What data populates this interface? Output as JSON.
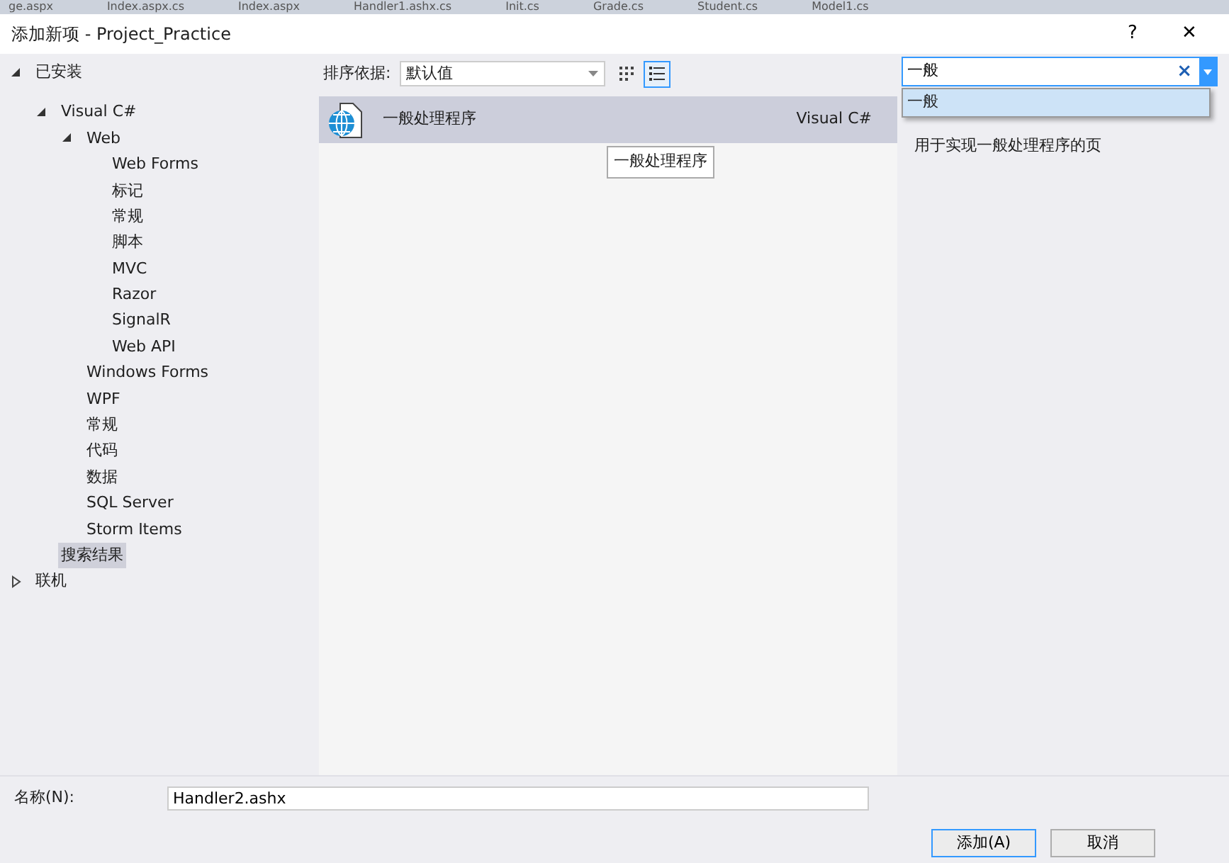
{
  "background_tabs": [
    "ge.aspx",
    "Index.aspx.cs",
    "Index.aspx",
    "Handler1.ashx.cs",
    "Init.cs",
    "Grade.cs",
    "Student.cs",
    "Model1.cs"
  ],
  "window": {
    "title": "添加新项 - Project_Practice",
    "help": "?",
    "close": "✕"
  },
  "tree": [
    {
      "label": "已安装",
      "expanded": true,
      "selected": false,
      "children": [
        {
          "label": "Visual C#",
          "expanded": true,
          "selected": false,
          "children": [
            {
              "label": "Web",
              "expanded": true,
              "selected": false,
              "children": [
                {
                  "label": "Web Forms",
                  "selected": false
                },
                {
                  "label": "标记",
                  "selected": false
                },
                {
                  "label": "常规",
                  "selected": false
                },
                {
                  "label": "脚本",
                  "selected": false
                },
                {
                  "label": "MVC",
                  "selected": false
                },
                {
                  "label": "Razor",
                  "selected": false
                },
                {
                  "label": "SignalR",
                  "selected": false
                },
                {
                  "label": "Web API",
                  "selected": false
                }
              ]
            },
            {
              "label": "Windows Forms",
              "selected": false
            },
            {
              "label": "WPF",
              "selected": false
            },
            {
              "label": "常规",
              "selected": false
            },
            {
              "label": "代码",
              "selected": false
            },
            {
              "label": "数据",
              "selected": false
            },
            {
              "label": "SQL Server",
              "selected": false
            },
            {
              "label": "Storm Items",
              "selected": false
            }
          ]
        },
        {
          "label": "搜索结果",
          "selected": true
        }
      ]
    },
    {
      "label": "联机",
      "expanded": false,
      "selected": false
    }
  ],
  "sort": {
    "label": "排序依据:",
    "value": "默认值"
  },
  "view_buttons": [
    {
      "kind": "grid",
      "selected": false
    },
    {
      "kind": "list",
      "selected": true
    }
  ],
  "templates": [
    {
      "name": "一般处理程序",
      "language": "Visual C#",
      "selected": true
    }
  ],
  "tooltip": "一般处理程序",
  "search": {
    "value": "一般",
    "clear": "×",
    "suggestions": [
      "一般"
    ]
  },
  "details": {
    "description": "用于实现一般处理程序的页"
  },
  "name_field": {
    "label": "名称(N):",
    "value": "Handler2.ashx"
  },
  "buttons": [
    "添加(A)",
    "取消"
  ]
}
